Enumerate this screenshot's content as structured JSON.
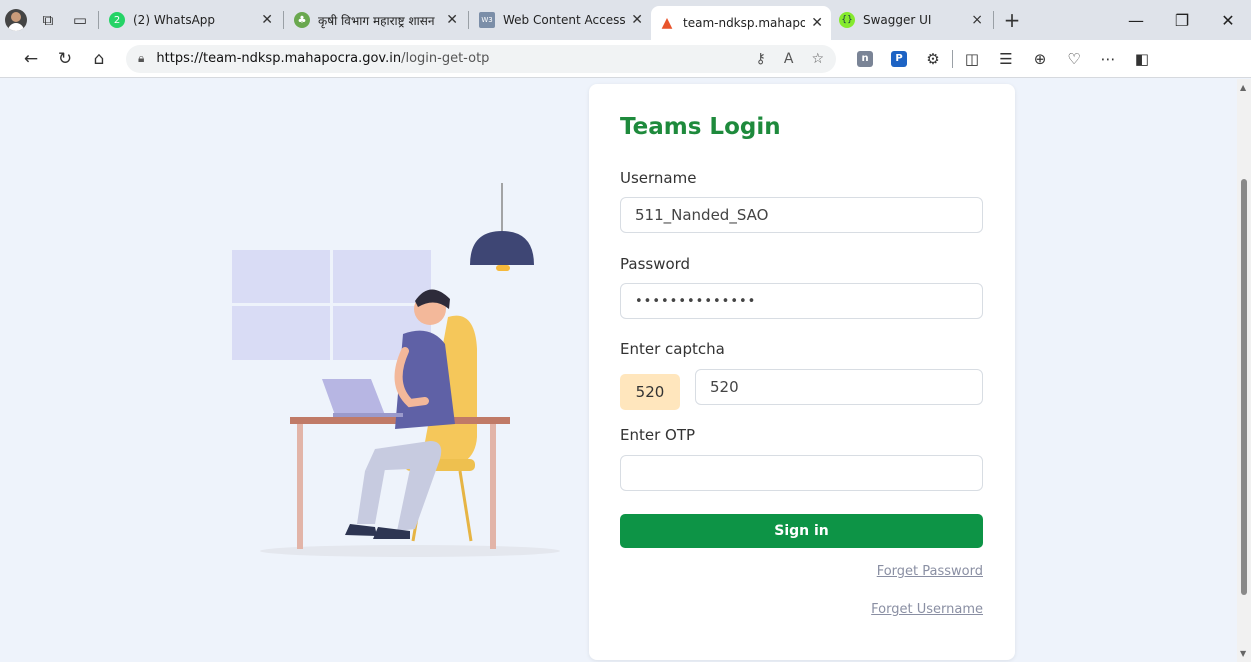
{
  "browser": {
    "tabs": [
      {
        "title": "(2) WhatsApp",
        "favicon": "whatsapp-icon",
        "color": "#25d366",
        "active": false
      },
      {
        "title": "कृषी विभाग महाराष्ट्र शासन",
        "favicon": "leaf-emblem-icon",
        "color": "#6aa84f",
        "active": false
      },
      {
        "title": "Web Content Accessibil",
        "favicon": "wcag-icon",
        "color": "#7b8ea8",
        "active": false
      },
      {
        "title": "team-ndksp.mahapocra",
        "favicon": "flame-icon",
        "color": "#e8542b",
        "active": true
      },
      {
        "title": "Swagger UI",
        "favicon": "swagger-icon",
        "color": "#85ea2d",
        "active": false
      }
    ],
    "whatsapp_badge": "2",
    "url_host": "https://team-ndksp.mahapocra.gov.in",
    "url_path": "/login-get-otp",
    "swagger_close": "×"
  },
  "login": {
    "title": "Teams Login",
    "username_label": "Username",
    "username_value": "511_Nanded_SAO",
    "password_label": "Password",
    "password_value": "••••••••••••••",
    "captcha_label": "Enter captcha",
    "captcha_code": "520",
    "captcha_value": "520",
    "otp_label": "Enter OTP",
    "otp_value": "",
    "signin_label": "Sign in",
    "forget_password": "Forget Password",
    "forget_username": "Forget Username"
  },
  "colors": {
    "brand_green": "#1e8a3c",
    "button_green": "#0d9446",
    "captcha_bg": "#ffe6bd",
    "page_bg": "#eef3fb"
  }
}
